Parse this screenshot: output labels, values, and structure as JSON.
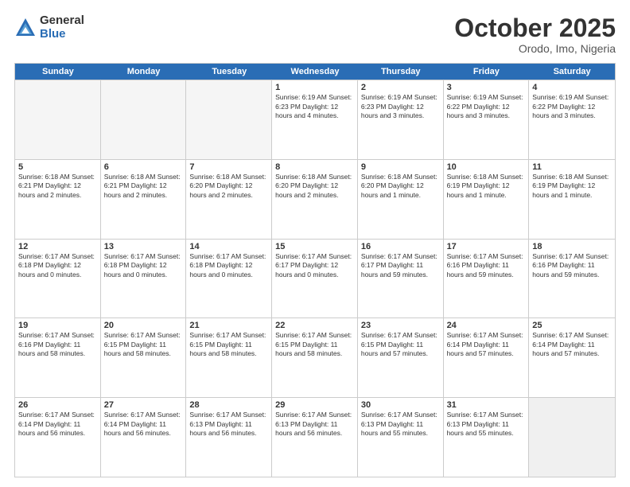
{
  "logo": {
    "general": "General",
    "blue": "Blue"
  },
  "title": "October 2025",
  "location": "Orodo, Imo, Nigeria",
  "weekdays": [
    "Sunday",
    "Monday",
    "Tuesday",
    "Wednesday",
    "Thursday",
    "Friday",
    "Saturday"
  ],
  "weeks": [
    [
      {
        "day": "",
        "info": "",
        "empty": true
      },
      {
        "day": "",
        "info": "",
        "empty": true
      },
      {
        "day": "",
        "info": "",
        "empty": true
      },
      {
        "day": "1",
        "info": "Sunrise: 6:19 AM\nSunset: 6:23 PM\nDaylight: 12 hours\nand 4 minutes."
      },
      {
        "day": "2",
        "info": "Sunrise: 6:19 AM\nSunset: 6:23 PM\nDaylight: 12 hours\nand 3 minutes."
      },
      {
        "day": "3",
        "info": "Sunrise: 6:19 AM\nSunset: 6:22 PM\nDaylight: 12 hours\nand 3 minutes."
      },
      {
        "day": "4",
        "info": "Sunrise: 6:19 AM\nSunset: 6:22 PM\nDaylight: 12 hours\nand 3 minutes."
      }
    ],
    [
      {
        "day": "5",
        "info": "Sunrise: 6:18 AM\nSunset: 6:21 PM\nDaylight: 12 hours\nand 2 minutes."
      },
      {
        "day": "6",
        "info": "Sunrise: 6:18 AM\nSunset: 6:21 PM\nDaylight: 12 hours\nand 2 minutes."
      },
      {
        "day": "7",
        "info": "Sunrise: 6:18 AM\nSunset: 6:20 PM\nDaylight: 12 hours\nand 2 minutes."
      },
      {
        "day": "8",
        "info": "Sunrise: 6:18 AM\nSunset: 6:20 PM\nDaylight: 12 hours\nand 2 minutes."
      },
      {
        "day": "9",
        "info": "Sunrise: 6:18 AM\nSunset: 6:20 PM\nDaylight: 12 hours\nand 1 minute."
      },
      {
        "day": "10",
        "info": "Sunrise: 6:18 AM\nSunset: 6:19 PM\nDaylight: 12 hours\nand 1 minute."
      },
      {
        "day": "11",
        "info": "Sunrise: 6:18 AM\nSunset: 6:19 PM\nDaylight: 12 hours\nand 1 minute."
      }
    ],
    [
      {
        "day": "12",
        "info": "Sunrise: 6:17 AM\nSunset: 6:18 PM\nDaylight: 12 hours\nand 0 minutes."
      },
      {
        "day": "13",
        "info": "Sunrise: 6:17 AM\nSunset: 6:18 PM\nDaylight: 12 hours\nand 0 minutes."
      },
      {
        "day": "14",
        "info": "Sunrise: 6:17 AM\nSunset: 6:18 PM\nDaylight: 12 hours\nand 0 minutes."
      },
      {
        "day": "15",
        "info": "Sunrise: 6:17 AM\nSunset: 6:17 PM\nDaylight: 12 hours\nand 0 minutes."
      },
      {
        "day": "16",
        "info": "Sunrise: 6:17 AM\nSunset: 6:17 PM\nDaylight: 11 hours\nand 59 minutes."
      },
      {
        "day": "17",
        "info": "Sunrise: 6:17 AM\nSunset: 6:16 PM\nDaylight: 11 hours\nand 59 minutes."
      },
      {
        "day": "18",
        "info": "Sunrise: 6:17 AM\nSunset: 6:16 PM\nDaylight: 11 hours\nand 59 minutes."
      }
    ],
    [
      {
        "day": "19",
        "info": "Sunrise: 6:17 AM\nSunset: 6:16 PM\nDaylight: 11 hours\nand 58 minutes."
      },
      {
        "day": "20",
        "info": "Sunrise: 6:17 AM\nSunset: 6:15 PM\nDaylight: 11 hours\nand 58 minutes."
      },
      {
        "day": "21",
        "info": "Sunrise: 6:17 AM\nSunset: 6:15 PM\nDaylight: 11 hours\nand 58 minutes."
      },
      {
        "day": "22",
        "info": "Sunrise: 6:17 AM\nSunset: 6:15 PM\nDaylight: 11 hours\nand 58 minutes."
      },
      {
        "day": "23",
        "info": "Sunrise: 6:17 AM\nSunset: 6:15 PM\nDaylight: 11 hours\nand 57 minutes."
      },
      {
        "day": "24",
        "info": "Sunrise: 6:17 AM\nSunset: 6:14 PM\nDaylight: 11 hours\nand 57 minutes."
      },
      {
        "day": "25",
        "info": "Sunrise: 6:17 AM\nSunset: 6:14 PM\nDaylight: 11 hours\nand 57 minutes."
      }
    ],
    [
      {
        "day": "26",
        "info": "Sunrise: 6:17 AM\nSunset: 6:14 PM\nDaylight: 11 hours\nand 56 minutes."
      },
      {
        "day": "27",
        "info": "Sunrise: 6:17 AM\nSunset: 6:14 PM\nDaylight: 11 hours\nand 56 minutes."
      },
      {
        "day": "28",
        "info": "Sunrise: 6:17 AM\nSunset: 6:13 PM\nDaylight: 11 hours\nand 56 minutes."
      },
      {
        "day": "29",
        "info": "Sunrise: 6:17 AM\nSunset: 6:13 PM\nDaylight: 11 hours\nand 56 minutes."
      },
      {
        "day": "30",
        "info": "Sunrise: 6:17 AM\nSunset: 6:13 PM\nDaylight: 11 hours\nand 55 minutes."
      },
      {
        "day": "31",
        "info": "Sunrise: 6:17 AM\nSunset: 6:13 PM\nDaylight: 11 hours\nand 55 minutes."
      },
      {
        "day": "",
        "info": "",
        "empty": true,
        "shaded": true
      }
    ]
  ]
}
